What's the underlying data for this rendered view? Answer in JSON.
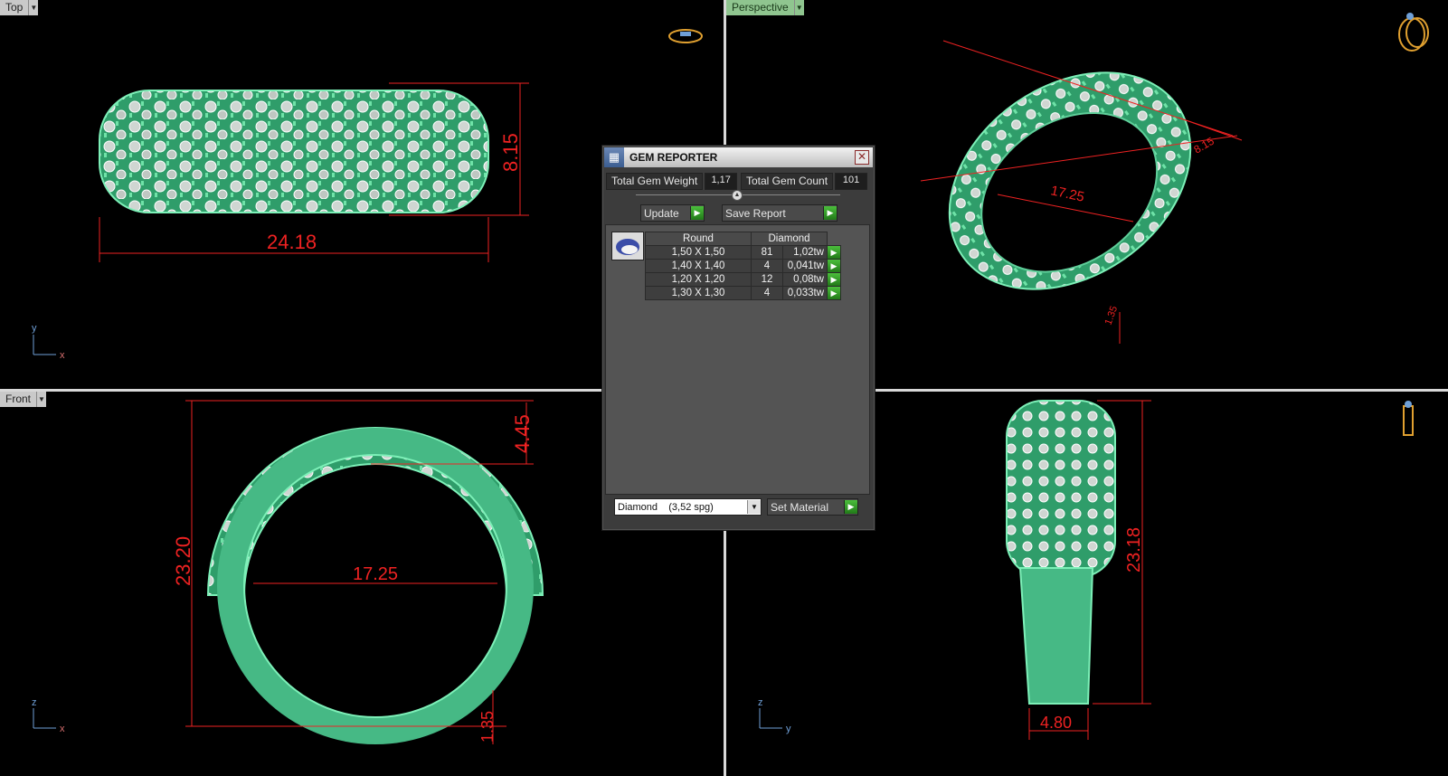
{
  "viewports": {
    "top": {
      "name": "Top",
      "axes": [
        "y",
        "x"
      ],
      "dims": {
        "width": "24.18",
        "height": "8.15"
      }
    },
    "perspective": {
      "name": "Perspective",
      "dims": {
        "inner": "17.25",
        "depth": "8.15",
        "wall": "1.35"
      }
    },
    "front": {
      "name": "Front",
      "axes": [
        "z",
        "x"
      ],
      "dims": {
        "height": "23.20",
        "top": "4.45",
        "inner": "17.25",
        "bottom": "1.35"
      }
    },
    "right": {
      "axes": [
        "z",
        "y"
      ],
      "dims": {
        "height": "23.18",
        "width": "4.80"
      }
    }
  },
  "gem_reporter": {
    "title": "GEM REPORTER",
    "close": "✕",
    "total_weight_label": "Total Gem Weight",
    "total_weight_value": "1,17",
    "total_count_label": "Total Gem Count",
    "total_count_value": "101",
    "update_label": "Update",
    "save_report_label": "Save Report",
    "table_headers": {
      "shape": "Round",
      "material": "Diamond"
    },
    "rows": [
      {
        "size": "1,50 X 1,50",
        "count": "81",
        "weight": "1,02tw"
      },
      {
        "size": "1,40 X 1,40",
        "count": "4",
        "weight": "0,041tw"
      },
      {
        "size": "1,20 X 1,20",
        "count": "12",
        "weight": "0,08tw"
      },
      {
        "size": "1,30 X 1,30",
        "count": "4",
        "weight": "0,033tw"
      }
    ],
    "material_selected": "Diamond    (3,52 spg)",
    "set_material_label": "Set Material"
  },
  "colors": {
    "model": "#3ea87a",
    "dimension": "#e22222",
    "panel": "#3c3c3c",
    "accent": "#2e9b22"
  }
}
